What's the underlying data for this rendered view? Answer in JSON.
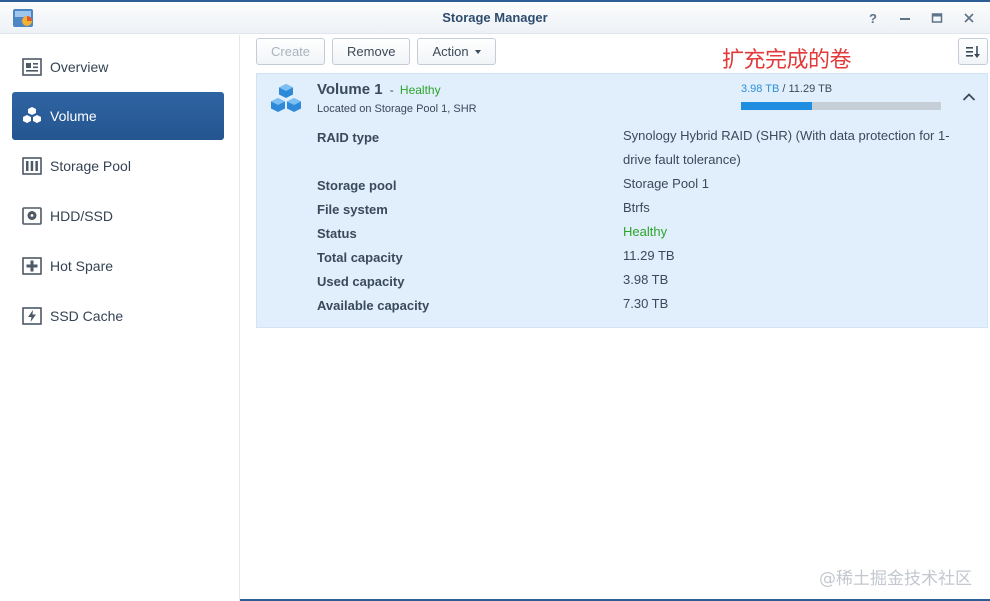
{
  "window": {
    "title": "Storage Manager",
    "help_glyph": "?"
  },
  "sidebar": {
    "items": [
      {
        "label": "Overview",
        "icon": "overview-icon",
        "active": false
      },
      {
        "label": "Volume",
        "icon": "cubes-icon",
        "active": true
      },
      {
        "label": "Storage Pool",
        "icon": "storage-pool-icon",
        "active": false
      },
      {
        "label": "HDD/SSD",
        "icon": "disk-icon",
        "active": false
      },
      {
        "label": "Hot Spare",
        "icon": "plus-icon",
        "active": false
      },
      {
        "label": "SSD Cache",
        "icon": "lightning-icon",
        "active": false
      }
    ]
  },
  "toolbar": {
    "create_label": "Create",
    "remove_label": "Remove",
    "action_label": "Action"
  },
  "annotation": "扩充完成的卷",
  "volume": {
    "name": "Volume 1",
    "separator": "-",
    "status": "Healthy",
    "location": "Located on Storage Pool 1, SHR",
    "used": "3.98 TB",
    "total_sep": "/ 11.29 TB",
    "usage_fraction": 0.353,
    "details": [
      {
        "label": "RAID type",
        "value": "Synology Hybrid RAID (SHR) (With data protection for 1-drive fault tolerance)"
      },
      {
        "label": "Storage pool",
        "value": "Storage Pool 1"
      },
      {
        "label": "File system",
        "value": "Btrfs"
      },
      {
        "label": "Status",
        "value": "Healthy"
      },
      {
        "label": "Total capacity",
        "value": "11.29 TB"
      },
      {
        "label": "Used capacity",
        "value": "3.98 TB"
      },
      {
        "label": "Available capacity",
        "value": "7.30 TB"
      }
    ]
  },
  "watermark": "@稀土掘金技术社区",
  "colors": {
    "accent": "#2b5e95",
    "healthy": "#2ca52c",
    "usage_bar": "#1f8de0",
    "panel": "#e1eefb",
    "annotation": "#e23a3a"
  }
}
